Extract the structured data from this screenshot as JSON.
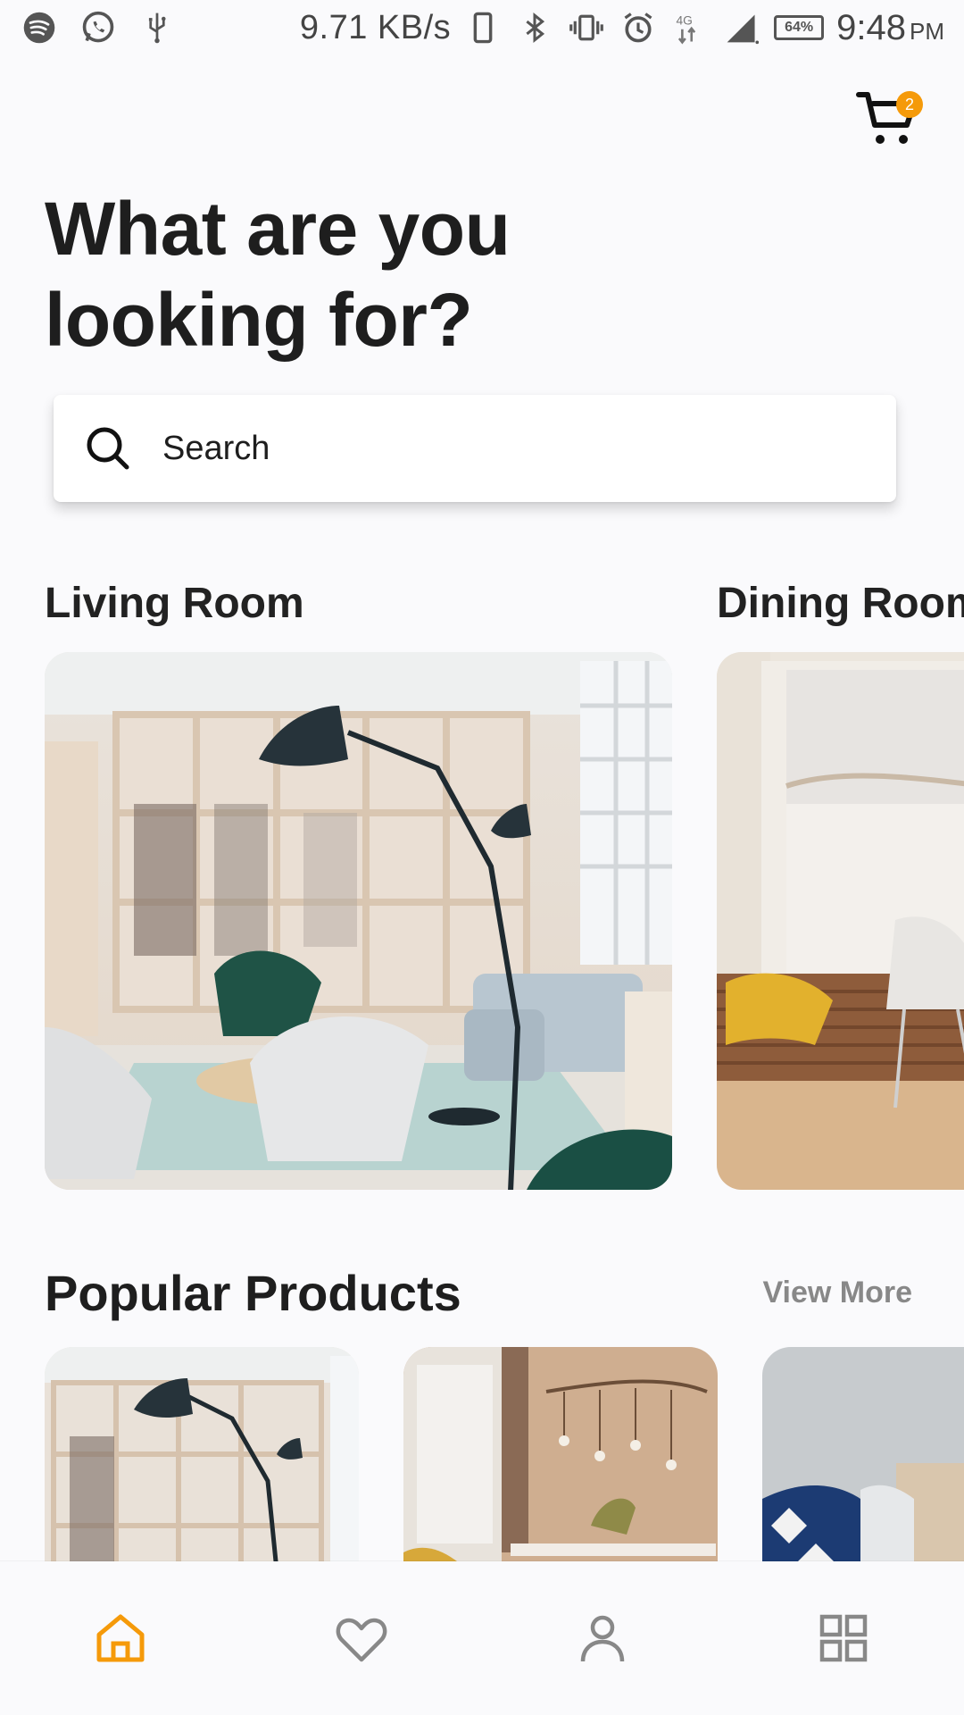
{
  "status_bar": {
    "network_speed": "9.71 KB/s",
    "network_type": "4G",
    "battery": "64%",
    "time": "9:48",
    "period": "PM"
  },
  "cart": {
    "count": "2"
  },
  "headline": "What are you looking for?",
  "search": {
    "placeholder": "Search"
  },
  "categories": [
    {
      "title": "Living Room"
    },
    {
      "title": "Dining Room"
    }
  ],
  "popular": {
    "title": "Popular Products",
    "view_more": "View More"
  },
  "nav": {
    "items": [
      "home-icon",
      "heart-icon",
      "user-icon",
      "grid-icon"
    ],
    "active_color": "#f59a0a",
    "inactive_color": "#888888"
  }
}
